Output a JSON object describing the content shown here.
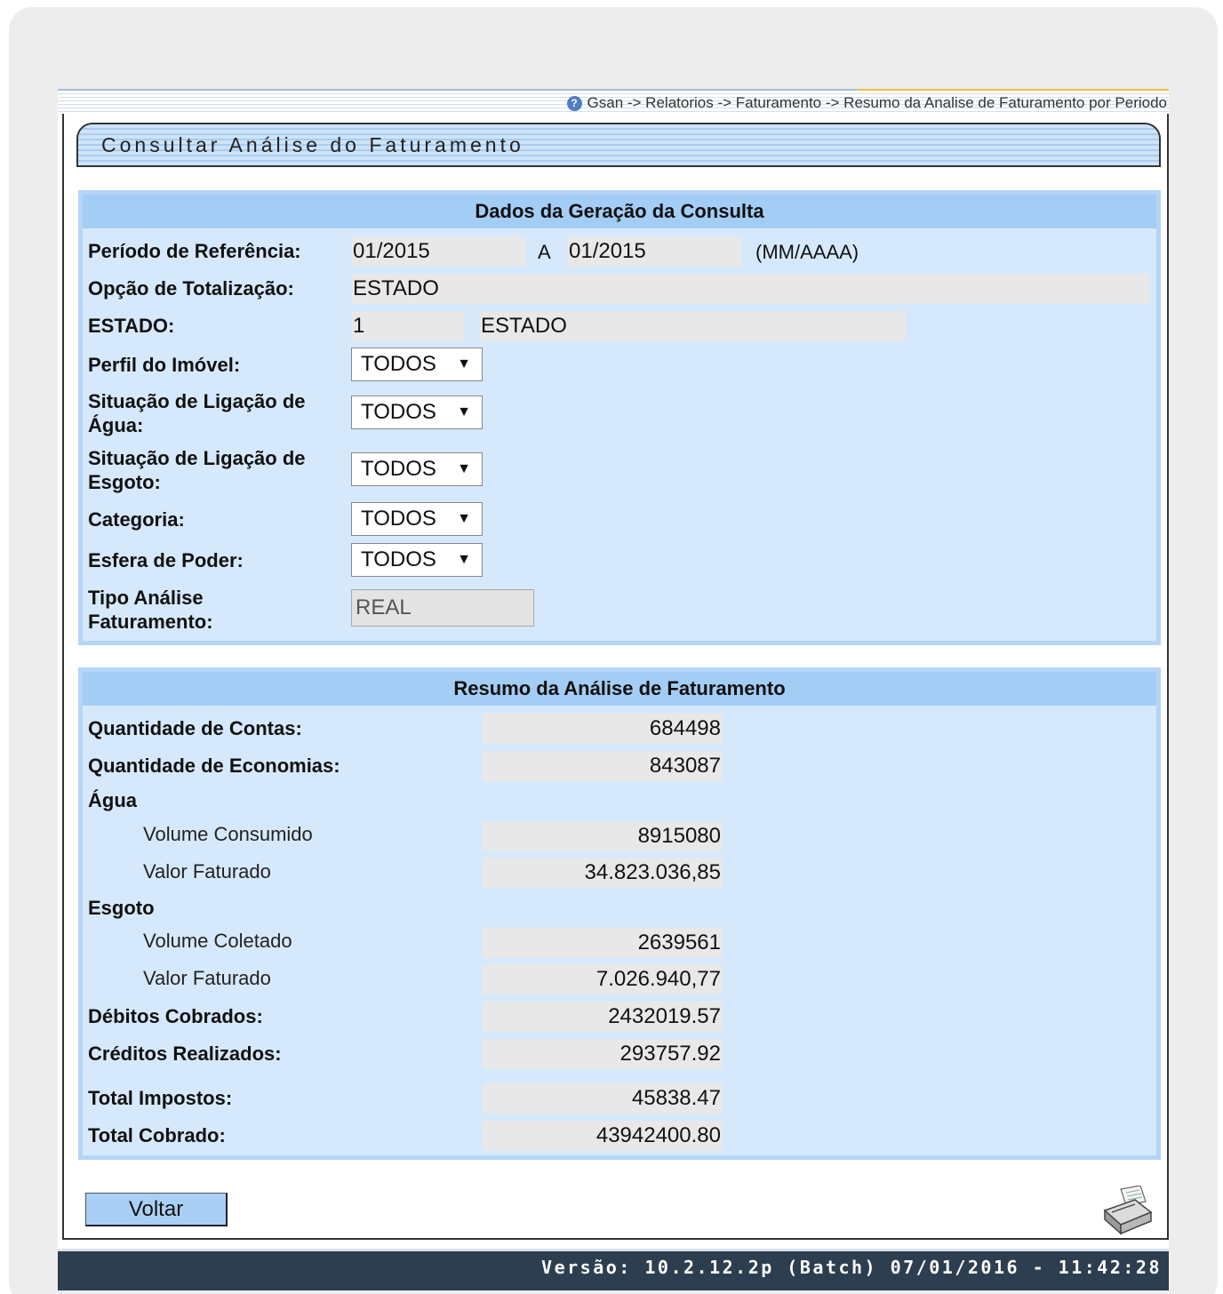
{
  "breadcrumb": "Gsan -> Relatorios -> Faturamento -> Resumo da Analise de Faturamento por Periodo",
  "page_title": "Consultar Análise do Faturamento",
  "geracao": {
    "header": "Dados da Geração da Consulta",
    "periodo_label": "Período de Referência:",
    "periodo_inicio": "01/2015",
    "periodo_sep": "A",
    "periodo_fim": "01/2015",
    "periodo_formato": "(MM/AAAA)",
    "opcao_label": "Opção de Totalização:",
    "opcao_value": "ESTADO",
    "estado_label": "ESTADO:",
    "estado_codigo": "1",
    "estado_nome": "ESTADO",
    "perfil_label": "Perfil do Imóvel:",
    "perfil_value": "TODOS",
    "sit_agua_label": "Situação de Ligação de Água:",
    "sit_agua_value": "TODOS",
    "sit_esgoto_label": "Situação de Ligação de Esgoto:",
    "sit_esgoto_value": "TODOS",
    "categoria_label": "Categoria:",
    "categoria_value": "TODOS",
    "esfera_label": "Esfera de Poder:",
    "esfera_value": "TODOS",
    "tipo_label": "Tipo Análise Faturamento:",
    "tipo_value": "REAL"
  },
  "resumo": {
    "header": "Resumo da Análise de Faturamento",
    "qtd_contas_label": "Quantidade de Contas:",
    "qtd_contas": "684498",
    "qtd_economias_label": "Quantidade de Economias:",
    "qtd_economias": "843087",
    "agua_label": "Água",
    "agua_volume_label": "Volume Consumido",
    "agua_volume": "8915080",
    "agua_valor_label": "Valor Faturado",
    "agua_valor": "34.823.036,85",
    "esgoto_label": "Esgoto",
    "esgoto_volume_label": "Volume Coletado",
    "esgoto_volume": "2639561",
    "esgoto_valor_label": "Valor Faturado",
    "esgoto_valor": "7.026.940,77",
    "debitos_label": "Débitos Cobrados:",
    "debitos": "2432019.57",
    "creditos_label": "Créditos Realizados:",
    "creditos": "293757.92",
    "impostos_label": "Total Impostos:",
    "impostos": "45838.47",
    "cobrado_label": "Total Cobrado:",
    "cobrado": "43942400.80"
  },
  "actions": {
    "voltar": "Voltar"
  },
  "footer": {
    "version": "Versão: 10.2.12.2p (Batch) 07/01/2016 - 11:42:28"
  },
  "icons": {
    "help": "help-icon",
    "print": "printer-icon",
    "dropdown": "chevron-down-icon"
  }
}
